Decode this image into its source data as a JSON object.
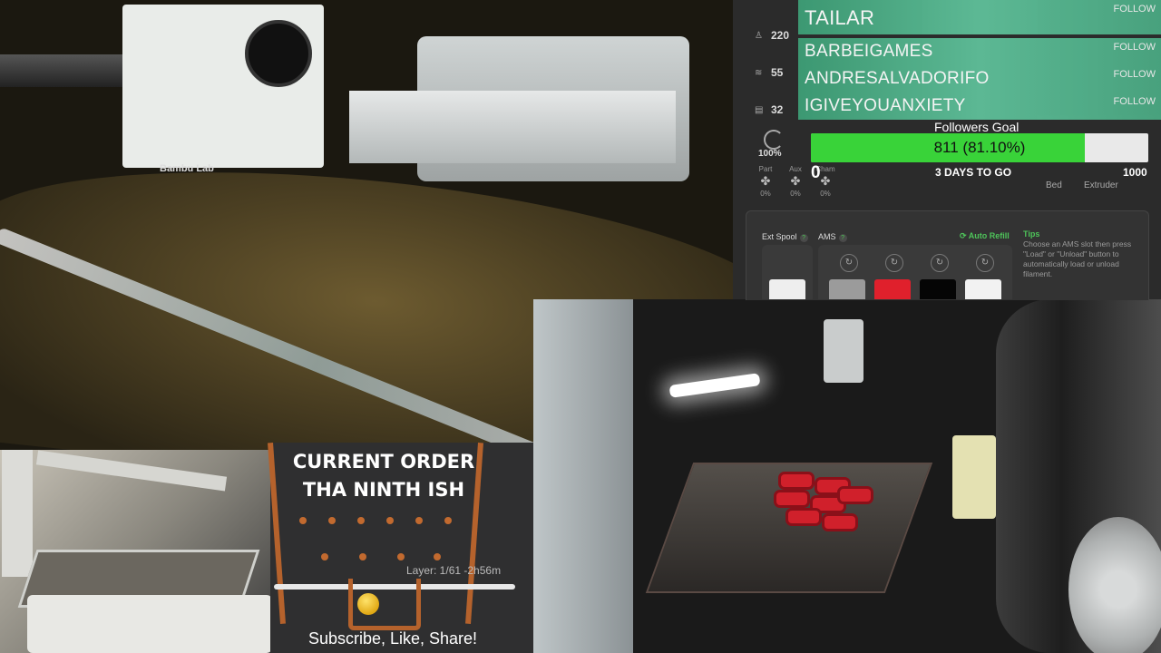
{
  "camera_main": {
    "brand_text": "Bambu Lab"
  },
  "printer_panel": {
    "stats": [
      {
        "icon": "nozzle-icon",
        "value": "220"
      },
      {
        "icon": "bed-heat-icon",
        "value": "55"
      },
      {
        "icon": "chamber-icon",
        "value": "32"
      }
    ],
    "speed_pct": "100%",
    "fans": [
      {
        "label": "Part",
        "pct": "0%"
      },
      {
        "label": "Aux",
        "pct": "0%"
      },
      {
        "label": "Cham",
        "pct": "0%"
      }
    ],
    "bed_label": "Bed",
    "extruder_label": "Extruder",
    "ext_spool_label": "Ext Spool",
    "ams_label": "AMS",
    "auto_refill_label": "Auto Refill",
    "tips_title": "Tips",
    "tips_text": "Choose an AMS slot then press \"Load\" or \"Unload\" button to automatically load or unload filament.",
    "ams_colors": [
      "#9b9b9b",
      "#e0202c",
      "#050505",
      "#f2f2f2"
    ],
    "ext_spool_color": "#eeeeee"
  },
  "followers": [
    {
      "name": "TAILAR",
      "action": "FOLLOW"
    },
    {
      "name": "BARBEIGAMES",
      "action": "FOLLOW"
    },
    {
      "name": "ANDRESALVADORIFO",
      "action": "FOLLOW"
    },
    {
      "name": "IGIVEYOUANXIETY",
      "action": "FOLLOW"
    }
  ],
  "followers_goal": {
    "title": "Followers Goal",
    "current_text": "811 (81.10%)",
    "progress": 0.811,
    "min": "0",
    "max": "1000",
    "days_left": "3 DAYS TO GO"
  },
  "order_panel": {
    "title_line1": "CURRENT ORDER",
    "title_line2": "THA NINTH ISH",
    "layer_text": "Layer: 1/61   -2h56m",
    "footer": "Subscribe, Like, Share!"
  }
}
